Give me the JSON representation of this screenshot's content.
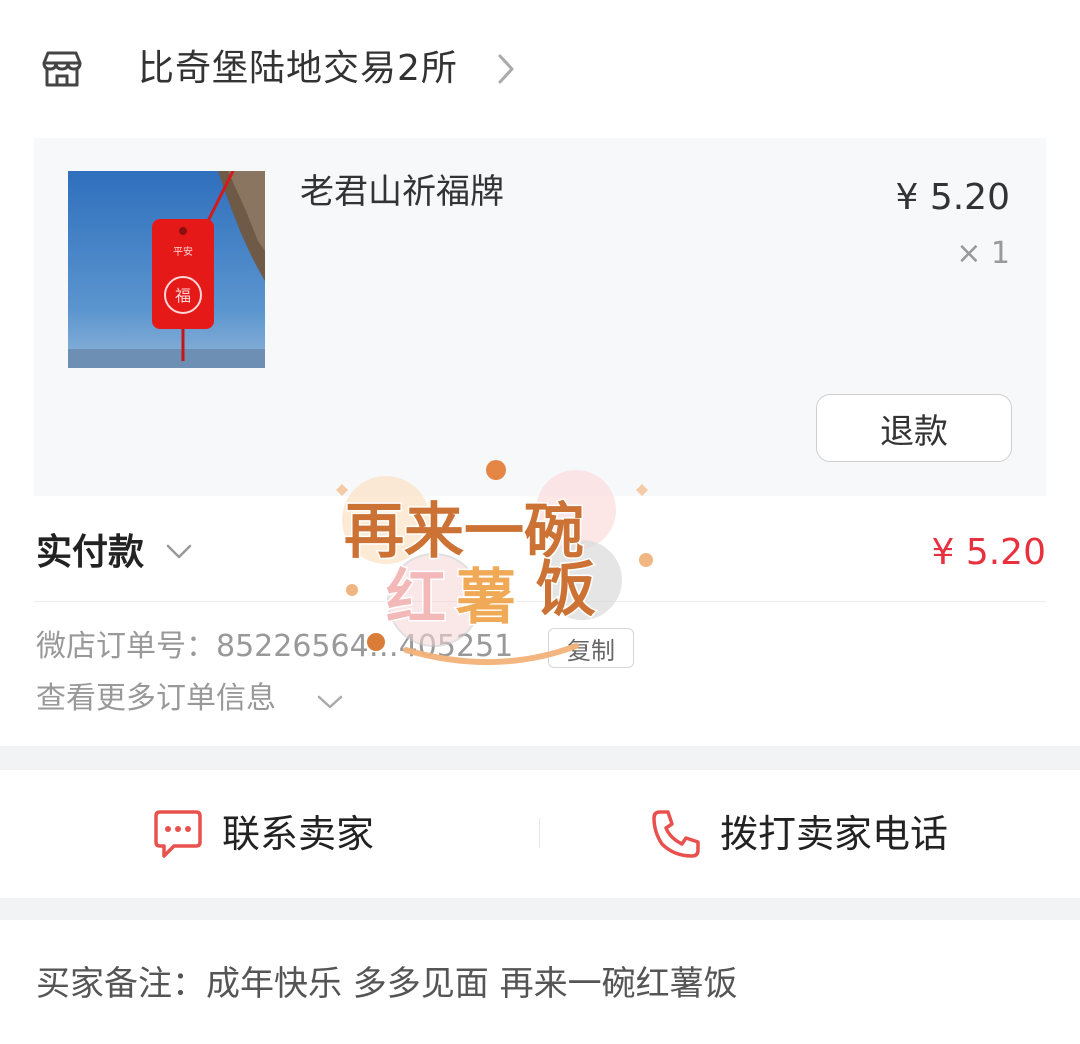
{
  "shop": {
    "name": "比奇堡陆地交易2所"
  },
  "product": {
    "name": "老君山祈福牌",
    "price": "¥ 5.20",
    "quantity": "× 1",
    "refund_label": "退款"
  },
  "payment": {
    "paid_label": "实付款",
    "paid_amount": "¥ 5.20"
  },
  "order": {
    "number_label": "微店订单号：",
    "number_value": "85226564…405251",
    "copy_label": "复制",
    "more_info_label": "查看更多订单信息"
  },
  "actions": {
    "contact_seller": "联系卖家",
    "call_seller": "拨打卖家电话"
  },
  "note": {
    "label": "买家备注：",
    "text": "成年快乐 多多见面 再来一碗红薯饭"
  },
  "sticker": {
    "text": "再来一碗红薯饭"
  },
  "colors": {
    "price_red": "#e8313f",
    "accent_icon": "#e8514d"
  }
}
